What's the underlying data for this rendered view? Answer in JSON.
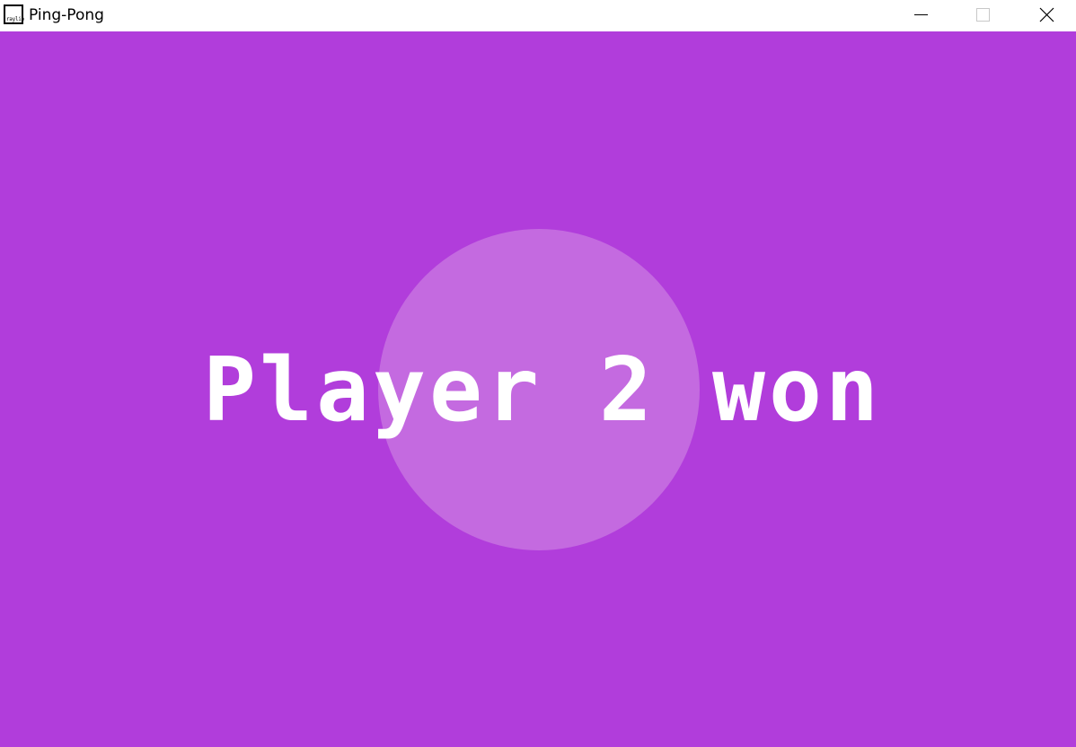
{
  "window": {
    "title": "Ping-Pong",
    "icon_label": "raylib",
    "icon_name": "raylib-app-icon",
    "controls": {
      "minimize_icon": "minimize-icon",
      "maximize_icon": "maximize-icon",
      "close_icon": "close-icon"
    }
  },
  "game": {
    "background_color": "#b13ddb",
    "ball_color": "#c46ae0",
    "text_color": "#ffffff",
    "message": "Player 2 won"
  }
}
